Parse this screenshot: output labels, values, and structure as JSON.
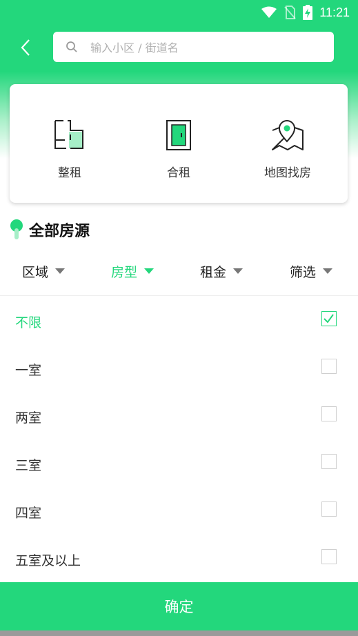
{
  "status_bar": {
    "time": "11:21"
  },
  "search": {
    "placeholder": "输入小区 / 街道名"
  },
  "categories": [
    {
      "label": "整租",
      "icon": "floorplan-icon"
    },
    {
      "label": "合租",
      "icon": "door-icon"
    },
    {
      "label": "地图找房",
      "icon": "map-pin-icon"
    }
  ],
  "section": {
    "title": "全部房源"
  },
  "filters": [
    {
      "label": "区域",
      "active": false
    },
    {
      "label": "房型",
      "active": true
    },
    {
      "label": "租金",
      "active": false
    },
    {
      "label": "筛选",
      "active": false
    }
  ],
  "options": [
    {
      "label": "不限",
      "checked": true
    },
    {
      "label": "一室",
      "checked": false
    },
    {
      "label": "两室",
      "checked": false
    },
    {
      "label": "三室",
      "checked": false
    },
    {
      "label": "四室",
      "checked": false
    },
    {
      "label": "五室及以上",
      "checked": false
    }
  ],
  "confirm": {
    "label": "确定"
  },
  "colors": {
    "accent": "#23d77c"
  }
}
